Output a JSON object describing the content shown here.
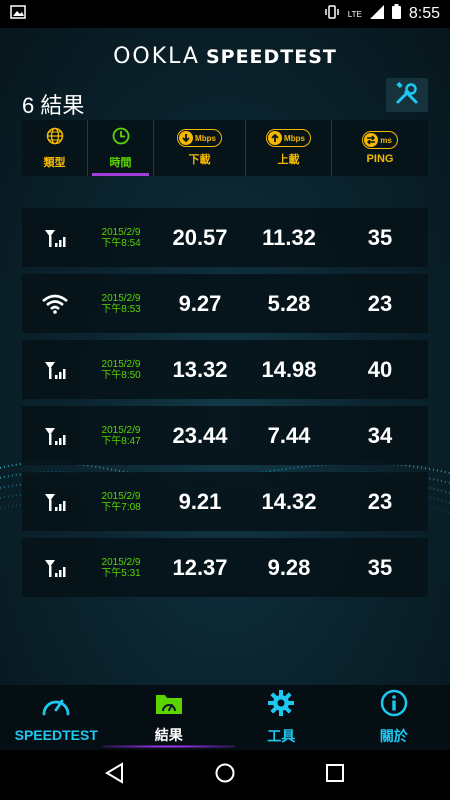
{
  "status_bar": {
    "time": "8:55",
    "network": "LTE"
  },
  "header": {
    "brand_ookla": "OOKLA",
    "brand_speedtest": "SPEEDTEST"
  },
  "results_count": "6 結果",
  "columns": {
    "type": "類型",
    "time": "時間",
    "download": "下載",
    "upload": "上載",
    "ping": "PING",
    "download_unit": "Mbps",
    "upload_unit": "Mbps",
    "ping_unit": "ms"
  },
  "results": [
    {
      "connection": "cellular-icon",
      "date": "2015/2/9",
      "time": "下午8:54",
      "download": "20.57",
      "upload": "11.32",
      "ping": "35"
    },
    {
      "connection": "wifi-icon",
      "date": "2015/2/9",
      "time": "下午8:53",
      "download": "9.27",
      "upload": "5.28",
      "ping": "23"
    },
    {
      "connection": "cellular-icon",
      "date": "2015/2/9",
      "time": "下午8:50",
      "download": "13.32",
      "upload": "14.98",
      "ping": "40"
    },
    {
      "connection": "cellular-icon",
      "date": "2015/2/9",
      "time": "下午8:47",
      "download": "23.44",
      "upload": "7.44",
      "ping": "34"
    },
    {
      "connection": "cellular-icon",
      "date": "2015/2/9",
      "time": "下午7:08",
      "download": "9.21",
      "upload": "14.32",
      "ping": "23"
    },
    {
      "connection": "cellular-icon",
      "date": "2015/2/9",
      "time": "下午5:31",
      "download": "12.37",
      "upload": "9.28",
      "ping": "35"
    }
  ],
  "bottom_nav": {
    "speedtest": "SPEEDTEST",
    "results": "結果",
    "tools": "工具",
    "about": "關於"
  },
  "colors": {
    "accent_cyan": "#1ec8f0",
    "accent_yellow": "#f5b800",
    "accent_green": "#5bd400",
    "accent_purple": "#a43dd8"
  }
}
